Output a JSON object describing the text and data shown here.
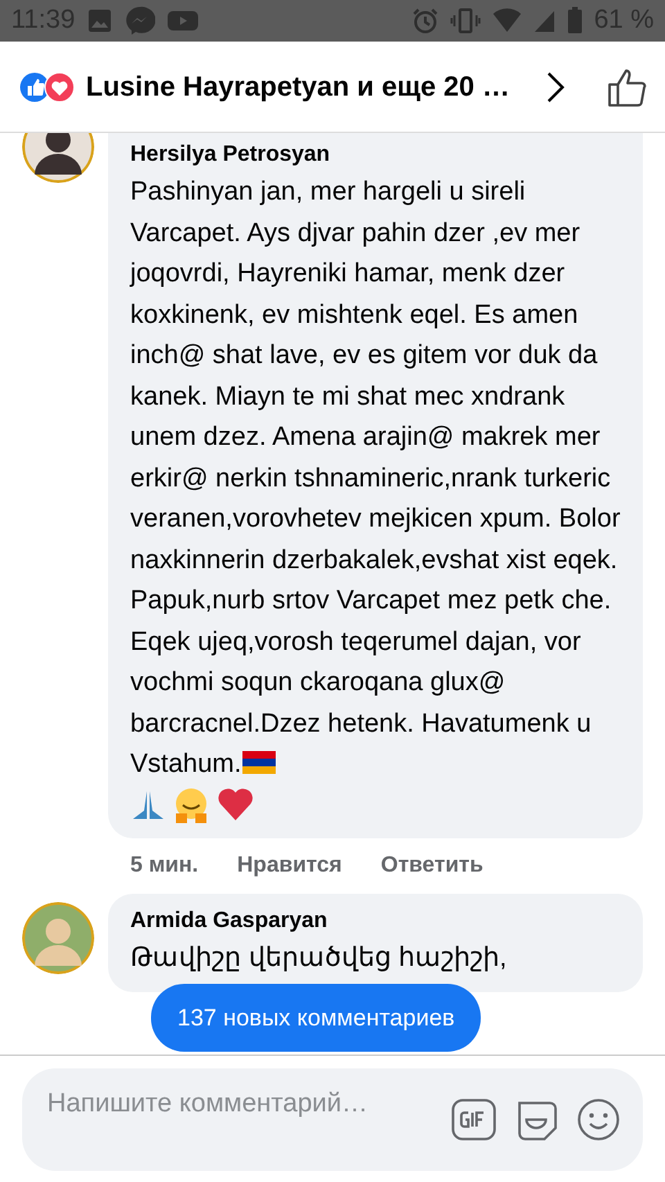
{
  "status_bar": {
    "time": "11:39",
    "battery": "61 %"
  },
  "header": {
    "title": "Lusine Hayrapetyan и еще 20 …"
  },
  "comments": [
    {
      "author": "Hersilya Petrosyan",
      "text": "Pashinyan jan, mer hargeli u sireli Varcapet. Ays djvar pahin dzer ,ev mer joqovrdi, Hayreniki hamar, menk dzer koxkinenk, ev mishtenk eqel. Es amen inch@ shat lave, ev es gitem vor duk da kanek. Miayn te mi shat mec xndrank unem dzez. Amena arajin@ makrek mer erkir@ nerkin tshnamineric,nrank turkeric veranen,vorovhetev mejkicen xpum. Bolor naxkinnerin dzerbakalek,evshat xist eqek. Papuk,nurb srtov Varcapet mez petk che. Eqek ujeq,vorosh teqerumel dajan, vor vochmi soqun ckaroqana glux@ barcracnel.Dzez hetenk. Havatumenk u Vstahum.",
      "time": "5 мин.",
      "like": "Нравится",
      "reply": "Ответить"
    },
    {
      "author": "Armida Gasparyan",
      "text": "Թավիշը վերածվեց հաշիշի,"
    }
  ],
  "new_comments": "137 новых комментариев",
  "composer": {
    "placeholder": "Напишите комментарий…"
  }
}
